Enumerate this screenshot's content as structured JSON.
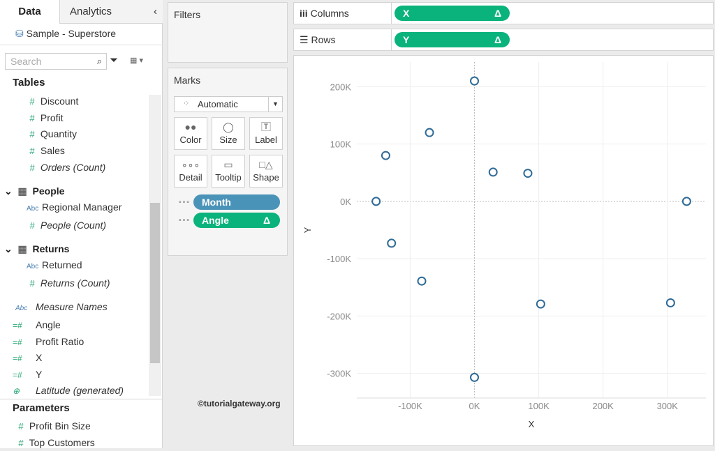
{
  "sidebar": {
    "tabs": [
      "Data",
      "Analytics"
    ],
    "datasource": "Sample - Superstore",
    "search_placeholder": "Search",
    "tables_label": "Tables",
    "measures": [
      "Discount",
      "Profit",
      "Quantity",
      "Sales",
      "Orders (Count)"
    ],
    "people": {
      "label": "People",
      "items": [
        "Regional Manager",
        "People (Count)"
      ]
    },
    "returns": {
      "label": "Returns",
      "items": [
        "Returned",
        "Returns (Count)"
      ]
    },
    "extra": [
      "Measure Names",
      "Angle",
      "Profit Ratio",
      "X",
      "Y",
      "Latitude (generated)"
    ],
    "parameters_label": "Parameters",
    "parameters": [
      "Profit Bin Size",
      "Top Customers"
    ]
  },
  "filters": {
    "title": "Filters"
  },
  "marks": {
    "title": "Marks",
    "type": "Automatic",
    "cards": [
      "Color",
      "Size",
      "Label",
      "Detail",
      "Tooltip",
      "Shape"
    ],
    "pills": [
      {
        "label": "Month",
        "color": "#4a93b8"
      },
      {
        "label": "Angle",
        "color": "#0ab37b",
        "delta": "Δ"
      }
    ]
  },
  "shelves": {
    "columns_label": "Columns",
    "rows_label": "Rows",
    "columns_pill": "X",
    "rows_pill": "Y",
    "delta": "Δ"
  },
  "watermark": "©tutorialgateway.org",
  "chart_data": {
    "type": "scatter",
    "xlabel": "X",
    "ylabel": "Y",
    "xlim": [
      -183,
      360
    ],
    "ylim": [
      -343,
      243
    ],
    "xticks": [
      -100,
      0,
      100,
      200,
      300
    ],
    "xtick_labels": [
      "-100K",
      "0K",
      "100K",
      "200K",
      "300K"
    ],
    "yticks": [
      200,
      100,
      0,
      -100,
      -200,
      -300
    ],
    "ytick_labels": [
      "200K",
      "100K",
      "0K",
      "-100K",
      "-200K",
      "-300K"
    ],
    "points": [
      [
        0,
        210
      ],
      [
        -70,
        120
      ],
      [
        -138,
        80
      ],
      [
        29,
        51
      ],
      [
        83,
        49
      ],
      [
        -153,
        0
      ],
      [
        330,
        0
      ],
      [
        -129,
        -73
      ],
      [
        -82,
        -139
      ],
      [
        103,
        -179
      ],
      [
        305,
        -177
      ],
      [
        0,
        -307
      ]
    ],
    "color": "#2e6a96"
  }
}
